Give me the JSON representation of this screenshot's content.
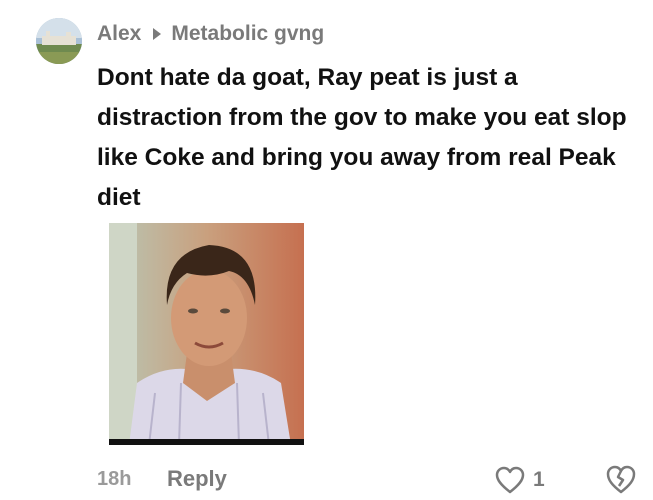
{
  "comment": {
    "author": "Alex",
    "community": "Metabolic gvng",
    "text": "Dont hate da goat, Ray peat is just a distraction from the gov to make you eat slop like Coke and bring you away from real Peak diet",
    "time_ago": "18h",
    "reply_label": "Reply",
    "like_count": "1"
  },
  "icons": {
    "separator": "caret-right-icon",
    "like": "heart-outline-icon",
    "dislike": "broken-heart-outline-icon"
  },
  "colors": {
    "author_text": "#7a7a7a",
    "body_text": "#111111",
    "meta_text": "#9a9a9a",
    "background": "#ffffff"
  }
}
